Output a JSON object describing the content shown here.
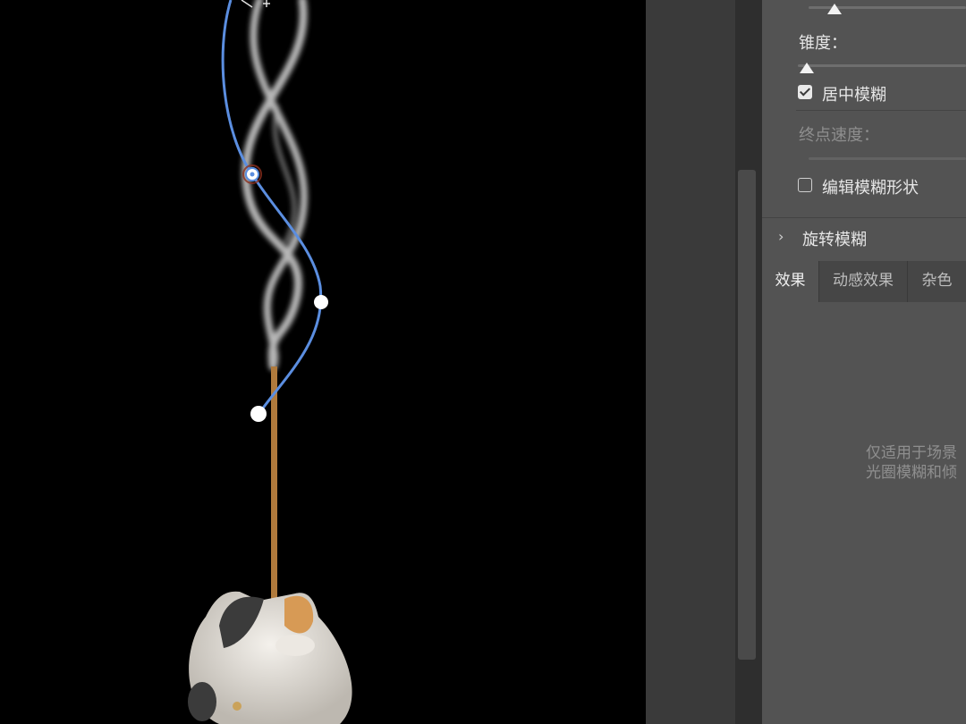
{
  "blur_gallery": {
    "taper_label": "锥度：",
    "center_blur_label": "居中模糊",
    "center_blur_checked": true,
    "end_speed_label": "终点速度：",
    "edit_shape_label": "编辑模糊形状",
    "edit_shape_checked": false,
    "spin_blur_label": "旋转模糊",
    "tabs": [
      {
        "label": "效果",
        "active": true
      },
      {
        "label": "动感效果",
        "active": false
      },
      {
        "label": "杂色",
        "active": false
      }
    ],
    "info_line1": "仅适用于场景",
    "info_line2": "光圈模糊和倾"
  },
  "colors": {
    "panel_bg": "#535353",
    "path_blue": "#5b8ee0",
    "canvas_bg": "#000000"
  }
}
